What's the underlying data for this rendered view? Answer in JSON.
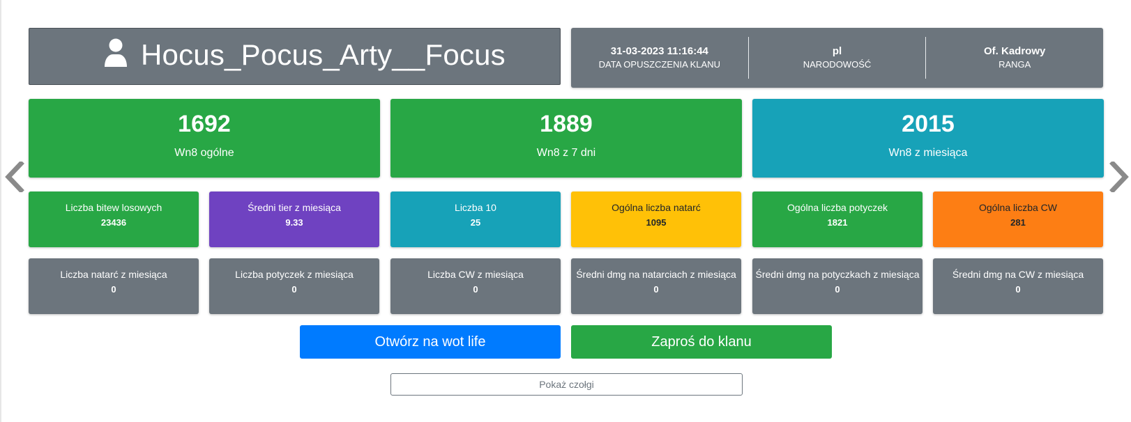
{
  "player": {
    "name": "Hocus_Pocus_Arty__Focus",
    "icon": "user-icon"
  },
  "info": [
    {
      "value": "31-03-2023 11:16:44",
      "label": "DATA OPUSZCZENIA KLANU"
    },
    {
      "value": "pl",
      "label": "NARODOWOŚĆ"
    },
    {
      "value": "Of. Kadrowy",
      "label": "RANGA"
    }
  ],
  "big_stats": [
    {
      "value": "1692",
      "label": "Wn8 ogólne",
      "color": "#28a745"
    },
    {
      "value": "1889",
      "label": "Wn8 z 7 dni",
      "color": "#28a745"
    },
    {
      "value": "2015",
      "label": "Wn8 z miesiąca",
      "color": "#17a2b8"
    }
  ],
  "stats_row1": [
    {
      "label": "Liczba bitew losowych",
      "value": "23436",
      "color": "#28a745"
    },
    {
      "label": "Średni tier z miesiąca",
      "value": "9.33",
      "color": "#6f42c1"
    },
    {
      "label": "Liczba 10",
      "value": "25",
      "color": "#17a2b8"
    },
    {
      "label": "Ogólna liczba natarć",
      "value": "1095",
      "color": "#ffc107"
    },
    {
      "label": "Ogólna liczba potyczek",
      "value": "1821",
      "color": "#28a745"
    },
    {
      "label": "Ogólna liczba CW",
      "value": "281",
      "color": "#fd7e14"
    }
  ],
  "stats_row2": [
    {
      "label": "Liczba natarć z miesiąca",
      "value": "0"
    },
    {
      "label": "Liczba potyczek z miesiąca",
      "value": "0"
    },
    {
      "label": "Liczba CW z miesiąca",
      "value": "0"
    },
    {
      "label": "Średni dmg na natarciach z miesiąca",
      "value": "0"
    },
    {
      "label": "Średni dmg na potyczkach z miesiąca",
      "value": "0"
    },
    {
      "label": "Średni dmg na CW z miesiąca",
      "value": "0"
    }
  ],
  "buttons": {
    "wotlife": "Otwórz na wot life",
    "invite": "Zaproś do klanu",
    "show_tanks": "Pokaż czołgi"
  },
  "navigation": {
    "prev_icon": "chevron-left-icon",
    "next_icon": "chevron-right-icon"
  }
}
